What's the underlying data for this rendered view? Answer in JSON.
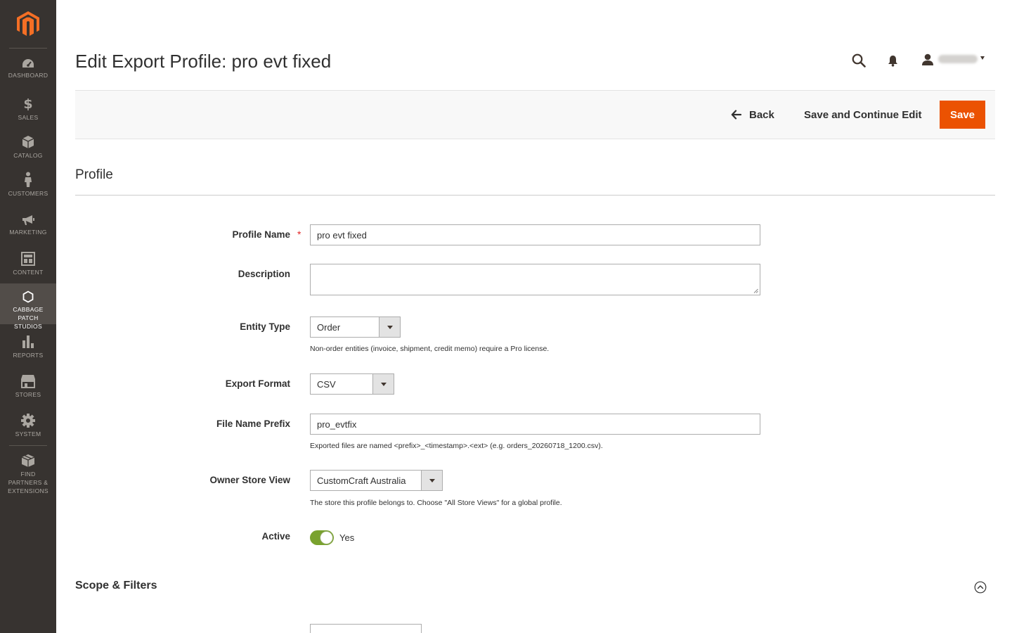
{
  "sidebar": {
    "items": [
      {
        "label": "Dashboard",
        "icon": "dashboard-icon"
      },
      {
        "label": "Sales",
        "icon": "dollar-icon"
      },
      {
        "label": "Catalog",
        "icon": "cube-icon"
      },
      {
        "label": "Customers",
        "icon": "person-icon"
      },
      {
        "label": "Marketing",
        "icon": "megaphone-icon"
      },
      {
        "label": "Content",
        "icon": "layout-icon"
      },
      {
        "label": "Cabbage Patch Studios",
        "icon": "hexagon-icon",
        "active": true
      },
      {
        "label": "Reports",
        "icon": "bar-chart-icon"
      },
      {
        "label": "Stores",
        "icon": "storefront-icon"
      },
      {
        "label": "System",
        "icon": "gear-icon"
      },
      {
        "label": "Find Partners & Extensions",
        "icon": "box-icon"
      }
    ]
  },
  "header": {
    "title": "Edit Export Profile: pro evt fixed"
  },
  "actions": {
    "back_label": "Back",
    "save_continue_label": "Save and Continue Edit",
    "save_label": "Save"
  },
  "form": {
    "section_title": "Profile",
    "profile_name": {
      "label": "Profile Name",
      "value": "pro evt fixed",
      "required": "*"
    },
    "description": {
      "label": "Description",
      "value": ""
    },
    "entity_type": {
      "label": "Entity Type",
      "value": "Order",
      "note": "Non-order entities (invoice, shipment, credit memo) require a Pro license."
    },
    "export_format": {
      "label": "Export Format",
      "value": "CSV"
    },
    "file_name_prefix": {
      "label": "File Name Prefix",
      "value": "pro_evtfix",
      "note": "Exported files are named <prefix>_<timestamp>.<ext> (e.g. orders_20260718_1200.csv)."
    },
    "owner_store_view": {
      "label": "Owner Store View",
      "value": "CustomCraft Australia",
      "note": "The store this profile belongs to. Choose \"All Store Views\" for a global profile."
    },
    "active": {
      "label": "Active",
      "value_label": "Yes"
    }
  },
  "scope": {
    "section_title": "Scope & Filters"
  },
  "colors": {
    "sidebar_bg": "#373330",
    "accent": "#eb5202",
    "toggle_on": "#79a22e"
  }
}
